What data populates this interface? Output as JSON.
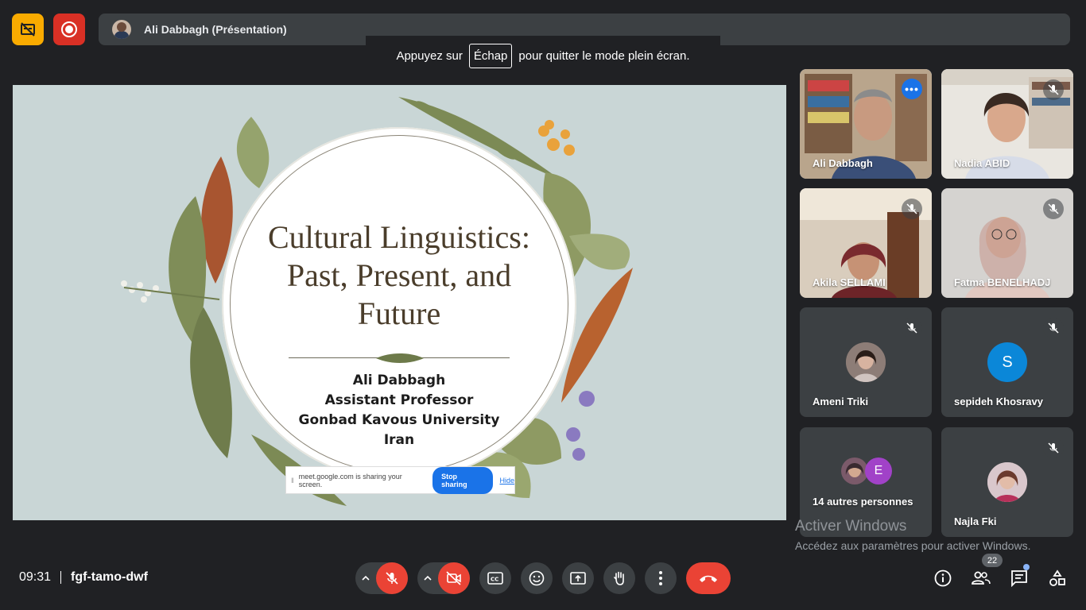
{
  "topbar": {
    "presenter_label": "Ali Dabbagh (Présentation)"
  },
  "fullscreen_toast": {
    "before": "Appuyez sur",
    "key": "Échap",
    "after": "pour quitter le mode plein écran."
  },
  "slide": {
    "title_lines": [
      "Cultural Linguistics:",
      "Past, Present, and",
      "Future"
    ],
    "info_lines": [
      "Ali Dabbagh",
      "Assistant Professor",
      "Gonbad Kavous University",
      "Iran"
    ]
  },
  "share_bar": {
    "message": "meet.google.com is sharing your screen.",
    "stop_label": "Stop sharing",
    "hide_label": "Hide"
  },
  "participants": [
    {
      "name": "Ali Dabbagh"
    },
    {
      "name": "Nadia ABID"
    },
    {
      "name": "Akila SELLAMI"
    },
    {
      "name": "Fatma BENELHADJ"
    },
    {
      "name": "Ameni Triki"
    },
    {
      "name": "sepideh Khosravy",
      "initial": "S"
    },
    {
      "name": "14 autres personnes",
      "initial": "E"
    },
    {
      "name": "Najla Fki"
    }
  ],
  "watermark": {
    "title": "Activer Windows",
    "subtitle": "Accédez aux paramètres pour activer Windows."
  },
  "footer": {
    "time": "09:31",
    "meeting_code": "fgf-tamo-dwf",
    "people_count": "22"
  },
  "colors": {
    "accent_blue": "#1a73e8",
    "danger_red": "#ea4335",
    "warning_yellow": "#f9ab00",
    "surface": "#3c4043",
    "background": "#202124"
  }
}
